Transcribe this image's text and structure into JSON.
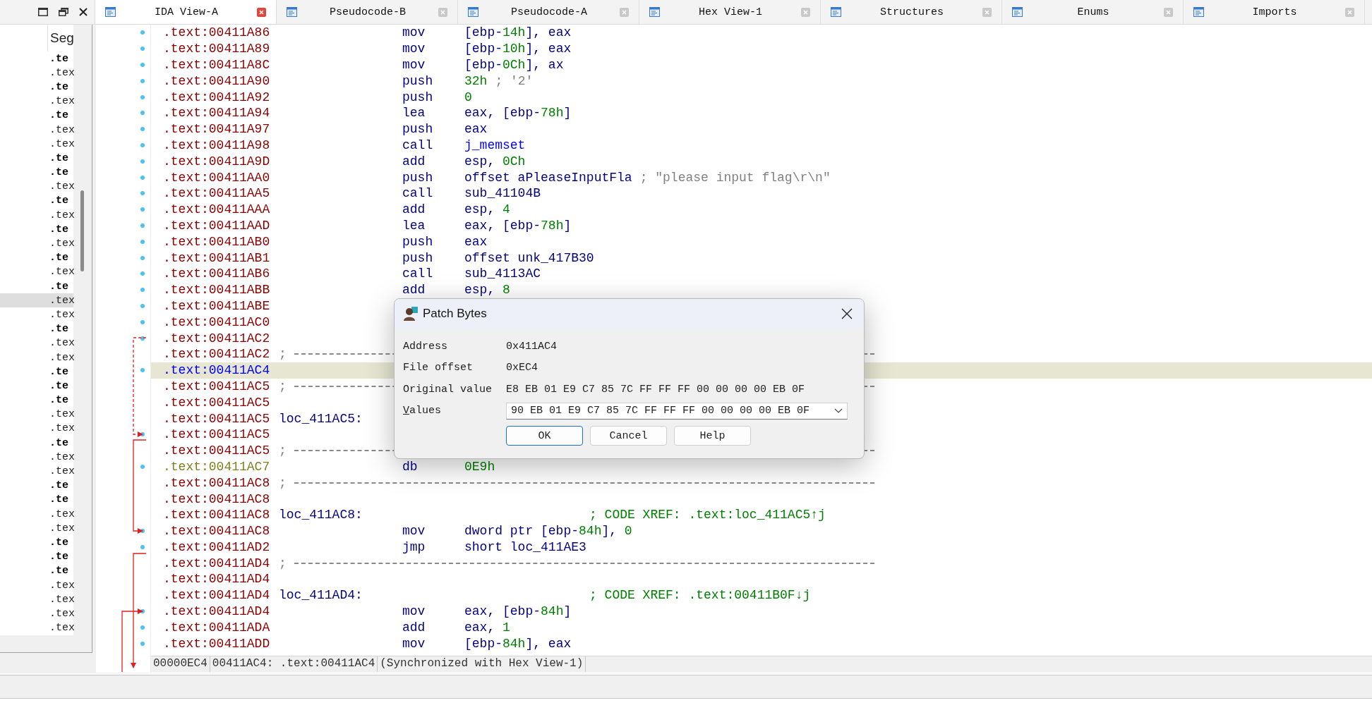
{
  "tabs": [
    {
      "label": "IDA View-A",
      "selected": true
    },
    {
      "label": "Pseudocode-B",
      "selected": false
    },
    {
      "label": "Pseudocode-A",
      "selected": false
    },
    {
      "label": "Hex View-1",
      "selected": false
    },
    {
      "label": "Structures",
      "selected": false
    },
    {
      "label": "Enums",
      "selected": false
    },
    {
      "label": "Imports",
      "selected": false
    }
  ],
  "segments_panel": {
    "header": "Seg",
    "rows": [
      {
        "text": ".te",
        "bold": true,
        "selected": false
      },
      {
        "text": ".tex",
        "bold": false,
        "selected": false
      },
      {
        "text": ".te",
        "bold": true,
        "selected": false
      },
      {
        "text": ".tex",
        "bold": false,
        "selected": false
      },
      {
        "text": ".te",
        "bold": true,
        "selected": false
      },
      {
        "text": ".tex",
        "bold": false,
        "selected": false
      },
      {
        "text": ".tex",
        "bold": false,
        "selected": false
      },
      {
        "text": ".te",
        "bold": true,
        "selected": false
      },
      {
        "text": ".te",
        "bold": true,
        "selected": false
      },
      {
        "text": ".tex",
        "bold": false,
        "selected": false
      },
      {
        "text": ".te",
        "bold": true,
        "selected": false
      },
      {
        "text": ".tex",
        "bold": false,
        "selected": false
      },
      {
        "text": ".te",
        "bold": true,
        "selected": false
      },
      {
        "text": ".tex",
        "bold": false,
        "selected": false
      },
      {
        "text": ".te",
        "bold": true,
        "selected": false
      },
      {
        "text": ".tex",
        "bold": false,
        "selected": false
      },
      {
        "text": ".te",
        "bold": true,
        "selected": false
      },
      {
        "text": ".tex",
        "bold": false,
        "selected": true
      },
      {
        "text": ".tex",
        "bold": false,
        "selected": false
      },
      {
        "text": ".te",
        "bold": true,
        "selected": false
      },
      {
        "text": ".tex",
        "bold": false,
        "selected": false
      },
      {
        "text": ".tex",
        "bold": false,
        "selected": false
      },
      {
        "text": ".te",
        "bold": true,
        "selected": false
      },
      {
        "text": ".te",
        "bold": true,
        "selected": false
      },
      {
        "text": ".te",
        "bold": true,
        "selected": false
      },
      {
        "text": ".tex",
        "bold": false,
        "selected": false
      },
      {
        "text": ".tex",
        "bold": false,
        "selected": false
      },
      {
        "text": ".te",
        "bold": true,
        "selected": false
      },
      {
        "text": ".tex",
        "bold": false,
        "selected": false
      },
      {
        "text": ".tex",
        "bold": false,
        "selected": false
      },
      {
        "text": ".te",
        "bold": true,
        "selected": false
      },
      {
        "text": ".te",
        "bold": true,
        "selected": false
      },
      {
        "text": ".tex",
        "bold": false,
        "selected": false
      },
      {
        "text": ".tex",
        "bold": false,
        "selected": false
      },
      {
        "text": ".te",
        "bold": true,
        "selected": false
      },
      {
        "text": ".te",
        "bold": true,
        "selected": false
      },
      {
        "text": ".te",
        "bold": true,
        "selected": false
      },
      {
        "text": ".tex",
        "bold": false,
        "selected": false
      },
      {
        "text": ".tex",
        "bold": false,
        "selected": false
      },
      {
        "text": ".tex",
        "bold": false,
        "selected": false
      },
      {
        "text": ".tex",
        "bold": false,
        "selected": false
      }
    ]
  },
  "disassembly": {
    "lines": [
      {
        "address": ".text:00411A86",
        "kind": "instruction",
        "marker": true,
        "selected": false,
        "mnemonic": "mov",
        "operand": [
          {
            "text": "[ebp-",
            "kind": "plain"
          },
          {
            "text": "14h",
            "kind": "number"
          },
          {
            "text": "], eax",
            "kind": "plain"
          }
        ]
      },
      {
        "address": ".text:00411A89",
        "kind": "instruction",
        "marker": true,
        "selected": false,
        "mnemonic": "mov",
        "operand": [
          {
            "text": "[ebp-",
            "kind": "plain"
          },
          {
            "text": "10h",
            "kind": "number"
          },
          {
            "text": "], eax",
            "kind": "plain"
          }
        ]
      },
      {
        "address": ".text:00411A8C",
        "kind": "instruction",
        "marker": true,
        "selected": false,
        "mnemonic": "mov",
        "operand": [
          {
            "text": "[ebp-",
            "kind": "plain"
          },
          {
            "text": "0Ch",
            "kind": "number"
          },
          {
            "text": "], ax",
            "kind": "plain"
          }
        ]
      },
      {
        "address": ".text:00411A90",
        "kind": "instruction",
        "marker": true,
        "selected": false,
        "mnemonic": "push",
        "operand": [
          {
            "text": "32h",
            "kind": "number"
          }
        ],
        "comment": {
          "text": "; '2'",
          "kind": "string"
        }
      },
      {
        "address": ".text:00411A92",
        "kind": "instruction",
        "marker": true,
        "selected": false,
        "mnemonic": "push",
        "operand": [
          {
            "text": "0",
            "kind": "number"
          }
        ]
      },
      {
        "address": ".text:00411A94",
        "kind": "instruction",
        "marker": true,
        "selected": false,
        "mnemonic": "lea",
        "operand": [
          {
            "text": "eax, [ebp-",
            "kind": "plain"
          },
          {
            "text": "78h",
            "kind": "number"
          },
          {
            "text": "]",
            "kind": "plain"
          }
        ]
      },
      {
        "address": ".text:00411A97",
        "kind": "instruction",
        "marker": true,
        "selected": false,
        "mnemonic": "push",
        "operand": [
          {
            "text": "eax",
            "kind": "plain"
          }
        ]
      },
      {
        "address": ".text:00411A98",
        "kind": "instruction",
        "marker": true,
        "selected": false,
        "mnemonic": "call",
        "operand": [
          {
            "text": "j_memset",
            "kind": "function"
          }
        ]
      },
      {
        "address": ".text:00411A9D",
        "kind": "instruction",
        "marker": true,
        "selected": false,
        "mnemonic": "add",
        "operand": [
          {
            "text": "esp, ",
            "kind": "plain"
          },
          {
            "text": "0Ch",
            "kind": "number"
          }
        ]
      },
      {
        "address": ".text:00411AA0",
        "kind": "instruction",
        "marker": true,
        "selected": false,
        "mnemonic": "push",
        "operand": [
          {
            "text": "offset aPleaseInputFla",
            "kind": "plain"
          }
        ],
        "comment": {
          "text": "; \"please input flag\\r\\n\"",
          "kind": "string"
        }
      },
      {
        "address": ".text:00411AA5",
        "kind": "instruction",
        "marker": true,
        "selected": false,
        "mnemonic": "call",
        "operand": [
          {
            "text": "sub_41104B",
            "kind": "plain"
          }
        ]
      },
      {
        "address": ".text:00411AAA",
        "kind": "instruction",
        "marker": true,
        "selected": false,
        "mnemonic": "add",
        "operand": [
          {
            "text": "esp, ",
            "kind": "plain"
          },
          {
            "text": "4",
            "kind": "number"
          }
        ]
      },
      {
        "address": ".text:00411AAD",
        "kind": "instruction",
        "marker": true,
        "selected": false,
        "mnemonic": "lea",
        "operand": [
          {
            "text": "eax, [ebp-",
            "kind": "plain"
          },
          {
            "text": "78h",
            "kind": "number"
          },
          {
            "text": "]",
            "kind": "plain"
          }
        ]
      },
      {
        "address": ".text:00411AB0",
        "kind": "instruction",
        "marker": true,
        "selected": false,
        "mnemonic": "push",
        "operand": [
          {
            "text": "eax",
            "kind": "plain"
          }
        ]
      },
      {
        "address": ".text:00411AB1",
        "kind": "instruction",
        "marker": true,
        "selected": false,
        "mnemonic": "push",
        "operand": [
          {
            "text": "offset unk_417B30",
            "kind": "plain"
          }
        ]
      },
      {
        "address": ".text:00411AB6",
        "kind": "instruction",
        "marker": true,
        "selected": false,
        "mnemonic": "call",
        "operand": [
          {
            "text": "sub_4113AC",
            "kind": "plain"
          }
        ]
      },
      {
        "address": ".text:00411ABB",
        "kind": "instruction",
        "marker": true,
        "selected": false,
        "mnemonic": "add",
        "operand": [
          {
            "text": "esp, ",
            "kind": "plain"
          },
          {
            "text": "8",
            "kind": "number"
          }
        ]
      },
      {
        "address": ".text:00411ABE",
        "kind": "blank",
        "marker": true,
        "selected": false
      },
      {
        "address": ".text:00411AC0",
        "kind": "blank",
        "marker": true,
        "selected": false
      },
      {
        "address": ".text:00411AC2",
        "kind": "blank",
        "marker": true,
        "selected": false
      },
      {
        "address": ".text:00411AC2",
        "kind": "separator",
        "marker": false,
        "selected": false,
        "text": ";"
      },
      {
        "address": ".text:00411AC4",
        "kind": "blank",
        "marker": true,
        "selected": true
      },
      {
        "address": ".text:00411AC5",
        "kind": "separator",
        "marker": false,
        "selected": false,
        "text": ";"
      },
      {
        "address": ".text:00411AC5",
        "kind": "blank",
        "marker": false,
        "selected": false
      },
      {
        "address": ".text:00411AC5",
        "kind": "label",
        "marker": false,
        "selected": false,
        "label": "loc_411AC5:"
      },
      {
        "address": ".text:00411AC5",
        "kind": "blank",
        "marker": true,
        "selected": false
      },
      {
        "address": ".text:00411AC5",
        "kind": "separator",
        "marker": false,
        "selected": false,
        "text": ";"
      },
      {
        "address": ".text:00411AC7",
        "kind": "data",
        "marker": true,
        "selected": false,
        "mnemonic": "db",
        "operand": [
          {
            "text": "0E9h",
            "kind": "number"
          }
        ]
      },
      {
        "address": ".text:00411AC8",
        "kind": "separator",
        "marker": false,
        "selected": false,
        "text": ";"
      },
      {
        "address": ".text:00411AC8",
        "kind": "blank",
        "marker": false,
        "selected": false
      },
      {
        "address": ".text:00411AC8",
        "kind": "label",
        "marker": false,
        "selected": false,
        "label": "loc_411AC8:",
        "comment": {
          "text": "; CODE XREF: .text:loc_411AC5↑j",
          "kind": "xref"
        }
      },
      {
        "address": ".text:00411AC8",
        "kind": "instruction",
        "marker": true,
        "selected": false,
        "mnemonic": "mov",
        "operand": [
          {
            "text": "dword ptr [ebp-",
            "kind": "plain"
          },
          {
            "text": "84h",
            "kind": "number"
          },
          {
            "text": "], ",
            "kind": "plain"
          },
          {
            "text": "0",
            "kind": "number"
          }
        ]
      },
      {
        "address": ".text:00411AD2",
        "kind": "instruction",
        "marker": true,
        "selected": false,
        "mnemonic": "jmp",
        "operand": [
          {
            "text": "short loc_411AE3",
            "kind": "plain"
          }
        ]
      },
      {
        "address": ".text:00411AD4",
        "kind": "separator",
        "marker": false,
        "selected": false,
        "text": ";"
      },
      {
        "address": ".text:00411AD4",
        "kind": "blank",
        "marker": false,
        "selected": false
      },
      {
        "address": ".text:00411AD4",
        "kind": "label",
        "marker": false,
        "selected": false,
        "label": "loc_411AD4:",
        "comment": {
          "text": "; CODE XREF: .text:00411B0F↓j",
          "kind": "xref"
        }
      },
      {
        "address": ".text:00411AD4",
        "kind": "instruction",
        "marker": true,
        "selected": false,
        "mnemonic": "mov",
        "operand": [
          {
            "text": "eax, [ebp-",
            "kind": "plain"
          },
          {
            "text": "84h",
            "kind": "number"
          },
          {
            "text": "]",
            "kind": "plain"
          }
        ]
      },
      {
        "address": ".text:00411ADA",
        "kind": "instruction",
        "marker": true,
        "selected": false,
        "mnemonic": "add",
        "operand": [
          {
            "text": "eax, ",
            "kind": "plain"
          },
          {
            "text": "1",
            "kind": "number"
          }
        ]
      },
      {
        "address": ".text:00411ADD",
        "kind": "instruction",
        "marker": true,
        "selected": false,
        "mnemonic": "mov",
        "operand": [
          {
            "text": "[ebp-",
            "kind": "plain"
          },
          {
            "text": "84h",
            "kind": "number"
          },
          {
            "text": "], eax",
            "kind": "plain"
          }
        ]
      }
    ],
    "status": [
      "00000EC4",
      "00411AC4: .text:00411AC4",
      "(Synchronized with Hex View-1)"
    ]
  },
  "dialog": {
    "title": "Patch Bytes",
    "fields": [
      {
        "label": "Address",
        "value": "0x411AC4"
      },
      {
        "label": "File offset",
        "value": "0xEC4"
      },
      {
        "label": "Original value",
        "value": "E8 EB 01 E9 C7 85 7C FF FF FF 00 00 00 00 EB 0F"
      }
    ],
    "values_field": {
      "label": "Values",
      "value": "90 EB 01 E9 C7 85 7C FF FF FF 00 00 00 00 EB 0F"
    },
    "buttons": [
      {
        "label": "OK",
        "focused": true
      },
      {
        "label": "Cancel",
        "focused": false
      },
      {
        "label": "Help",
        "focused": false
      }
    ]
  }
}
